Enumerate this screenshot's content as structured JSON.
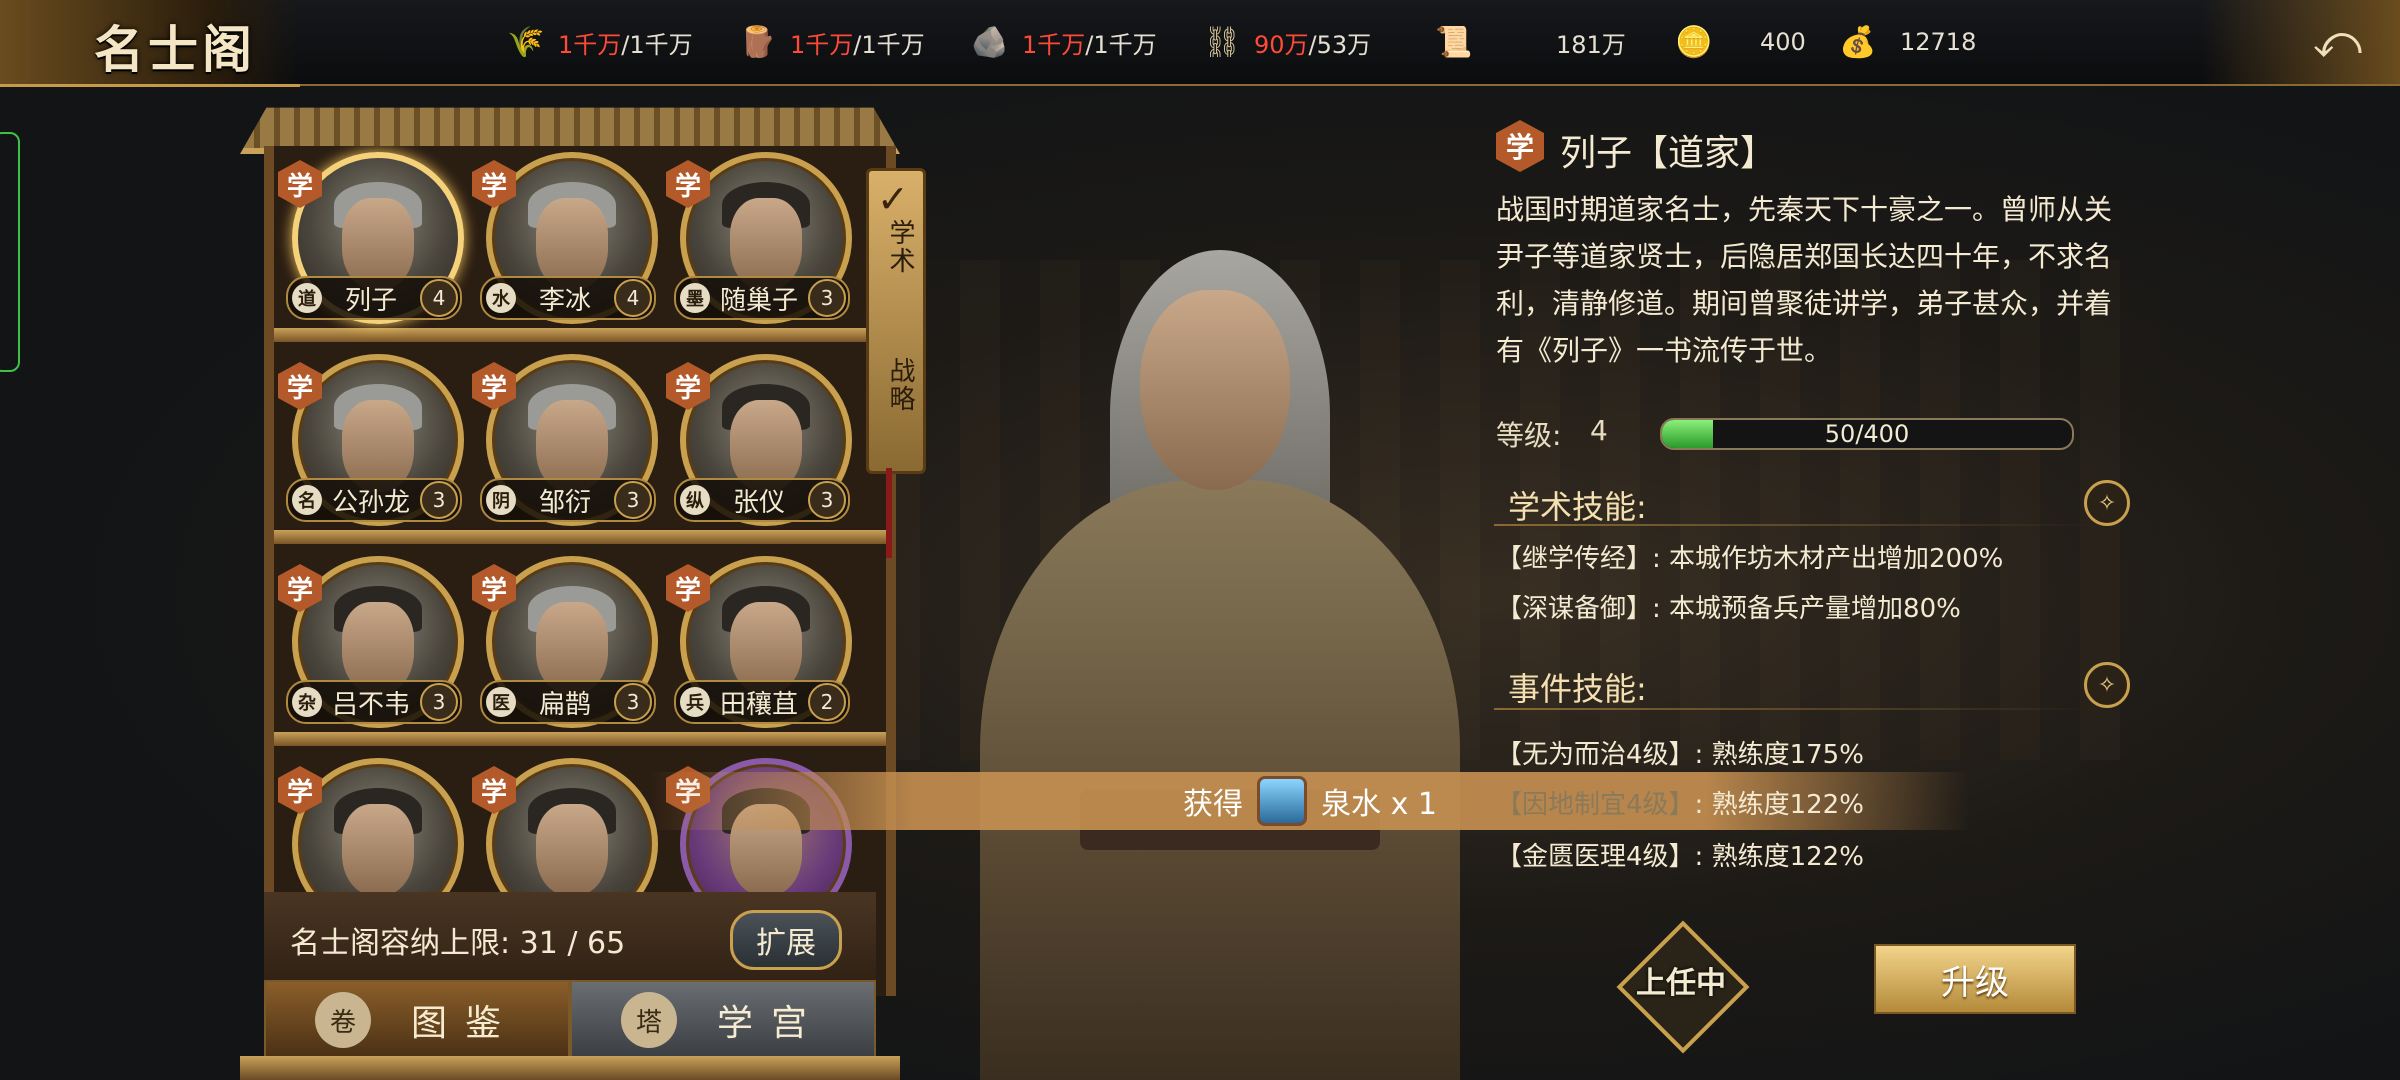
{
  "header": {
    "title": "名士阁",
    "resources": [
      {
        "icon": "wheat-icon",
        "glyph": "🌾",
        "current": "1千万",
        "max": "/1千万"
      },
      {
        "icon": "wood-log-icon",
        "glyph": "🪵",
        "current": "1千万",
        "max": "/1千万"
      },
      {
        "icon": "stone-icon",
        "glyph": "🪨",
        "current": "1千万",
        "max": "/1千万"
      },
      {
        "icon": "iron-icon",
        "glyph": "⛓",
        "current": "90万",
        "max": "/53万"
      },
      {
        "icon": "scroll-icon",
        "glyph": "📜",
        "current": "",
        "max": "181万"
      },
      {
        "icon": "gold-ingot-icon",
        "glyph": "🪙",
        "current": "",
        "max": "400"
      },
      {
        "icon": "silver-ingot-icon",
        "glyph": "💰",
        "current": "",
        "max": "12718"
      }
    ],
    "back_glyph": "⤺"
  },
  "roster": {
    "side_tabs": [
      {
        "label": "学术"
      },
      {
        "label": "战略"
      }
    ],
    "heroes": [
      {
        "badge": "学",
        "school": "道",
        "name": "列子",
        "level": "4"
      },
      {
        "badge": "学",
        "school": "水",
        "name": "李冰",
        "level": "4"
      },
      {
        "badge": "学",
        "school": "墨",
        "name": "随巢子",
        "level": "3"
      },
      {
        "badge": "学",
        "school": "名",
        "name": "公孙龙",
        "level": "3"
      },
      {
        "badge": "学",
        "school": "阴",
        "name": "邹衍",
        "level": "3"
      },
      {
        "badge": "学",
        "school": "纵",
        "name": "张仪",
        "level": "3"
      },
      {
        "badge": "学",
        "school": "杂",
        "name": "吕不韦",
        "level": "3"
      },
      {
        "badge": "学",
        "school": "医",
        "name": "扁鹊",
        "level": "3"
      },
      {
        "badge": "学",
        "school": "兵",
        "name": "田穰苴",
        "level": "2"
      },
      {
        "badge": "学"
      },
      {
        "badge": "学"
      },
      {
        "badge": "学"
      }
    ],
    "capacity": "名士阁容纳上限: 31 / 65",
    "expand_label": "扩展",
    "bottom_tabs": [
      {
        "label": "图鉴",
        "icon": "scroll-map-icon"
      },
      {
        "label": "学宫",
        "icon": "pagoda-icon"
      }
    ]
  },
  "notification": {
    "prefix": "获得",
    "item": "泉水 x 1"
  },
  "detail": {
    "badge": "学",
    "name": "列子【道家】",
    "description": "战国时期道家名士，先秦天下十豪之一。曾师从关尹子等道家贤士，后隐居郑国长达四十年，不求名利，清静修道。期间曾聚徒讲学，弟子甚众，并着有《列子》一书流传于世。",
    "level_label": "等级:",
    "level_value": "4",
    "exp_text": "50/400",
    "exp_current": 50,
    "exp_max": 400,
    "academic_title": "学术技能:",
    "academic_skills": [
      "【继学传经】: 本城作坊木材产出增加200%",
      "【深谋备御】: 本城预备兵产量增加80%"
    ],
    "event_title": "事件技能:",
    "event_skills": [
      {
        "name": "【无为而治4级】",
        "value": ": 熟练度175%",
        "dim": false
      },
      {
        "name": "【因地制宜4级】",
        "value": ": 熟练度122%",
        "dim": true
      },
      {
        "name": "【金匮医理4级】",
        "value": ": 熟练度122%",
        "dim": false
      }
    ],
    "onduty_label": "上任中",
    "upgrade_label": "升级"
  }
}
